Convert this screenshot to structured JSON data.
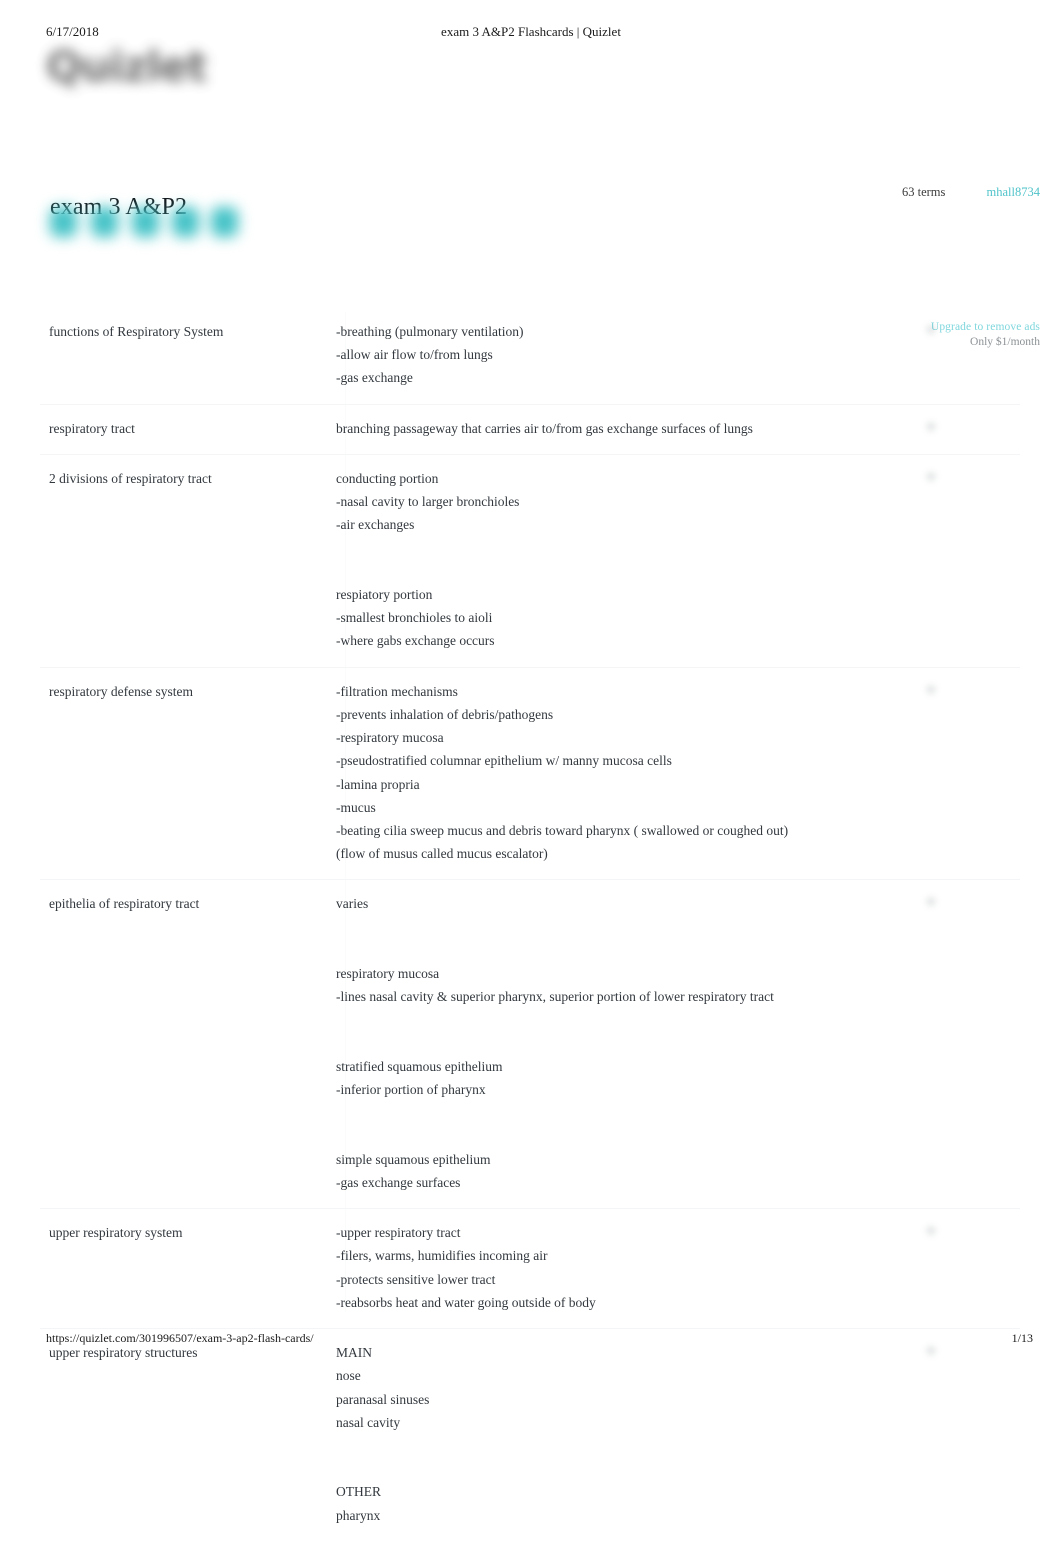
{
  "print_header": {
    "date": "6/17/2018",
    "title": "exam 3 A&P2 Flashcards | Quizlet"
  },
  "brand": {
    "logo_text": "Quizlet",
    "logo_color": "#585858"
  },
  "set_header": {
    "title": "exam 3 A&P2",
    "terms_count": "63 terms",
    "author": "mhall8734",
    "author_color": "#4fc3c9",
    "mode_buttons": [
      {
        "icon": "flashcards-mode-icon",
        "color": "#45c3c7"
      },
      {
        "icon": "learn-mode-icon",
        "color": "#45c3c7"
      },
      {
        "icon": "write-mode-icon",
        "color": "#45c3c7"
      },
      {
        "icon": "spell-mode-icon",
        "color": "#45c3c7"
      },
      {
        "icon": "test-mode-icon",
        "color": "#45c3c7"
      }
    ]
  },
  "ad": {
    "upgrade_label": "Upgrade to remove ads",
    "price_label": "Only $1/month",
    "link_color": "#7fd7dc"
  },
  "terms": [
    {
      "term": "functions of Respiratory System",
      "definition": "-breathing (pulmonary ventilation)\n-allow air flow to/from lungs\n-gas exchange",
      "star_icon": "star-icon"
    },
    {
      "term": "respiratory tract",
      "definition": "branching passageway that carries air to/from gas exchange surfaces of lungs",
      "star_icon": "star-icon"
    },
    {
      "term": "2 divisions of respiratory tract",
      "definition": "conducting portion\n-nasal cavity to larger bronchioles\n-air exchanges\n\n\nrespiatory portion\n-smallest bronchioles to aioli\n-where gabs exchange occurs",
      "star_icon": "star-icon"
    },
    {
      "term": "respiratory defense system",
      "definition": "-filtration mechanisms\n-prevents inhalation of debris/pathogens\n-respiratory mucosa\n-pseudostratified columnar epithelium w/ manny mucosa cells\n-lamina propria\n-mucus\n-beating cilia sweep mucus and debris toward pharynx ( swallowed or coughed out)\n(flow of musus called mucus escalator)",
      "star_icon": "star-icon"
    },
    {
      "term": "epithelia of respiratory tract",
      "definition": "varies\n\n\nrespiratory mucosa\n-lines nasal cavity & superior pharynx, superior portion of lower respiratory tract\n\n\nstratified squamous epithelium\n-inferior portion of pharynx\n\n\nsimple squamous epithelium\n-gas exchange surfaces",
      "star_icon": "star-icon"
    },
    {
      "term": "upper respiratory system",
      "definition": "-upper respiratory tract\n-filers, warms, humidifies incoming air\n-protects sensitive lower tract\n-reabsorbs heat and water going outside of body",
      "star_icon": "star-icon"
    },
    {
      "term": "upper respiratory structures",
      "definition": "MAIN\nnose\nparanasal sinuses\nnasal cavity\n\n\nOTHER\npharynx",
      "star_icon": "star-icon"
    }
  ],
  "print_footer": {
    "url": "https://quizlet.com/301996507/exam-3-ap2-flash-cards/",
    "page": "1/13"
  }
}
